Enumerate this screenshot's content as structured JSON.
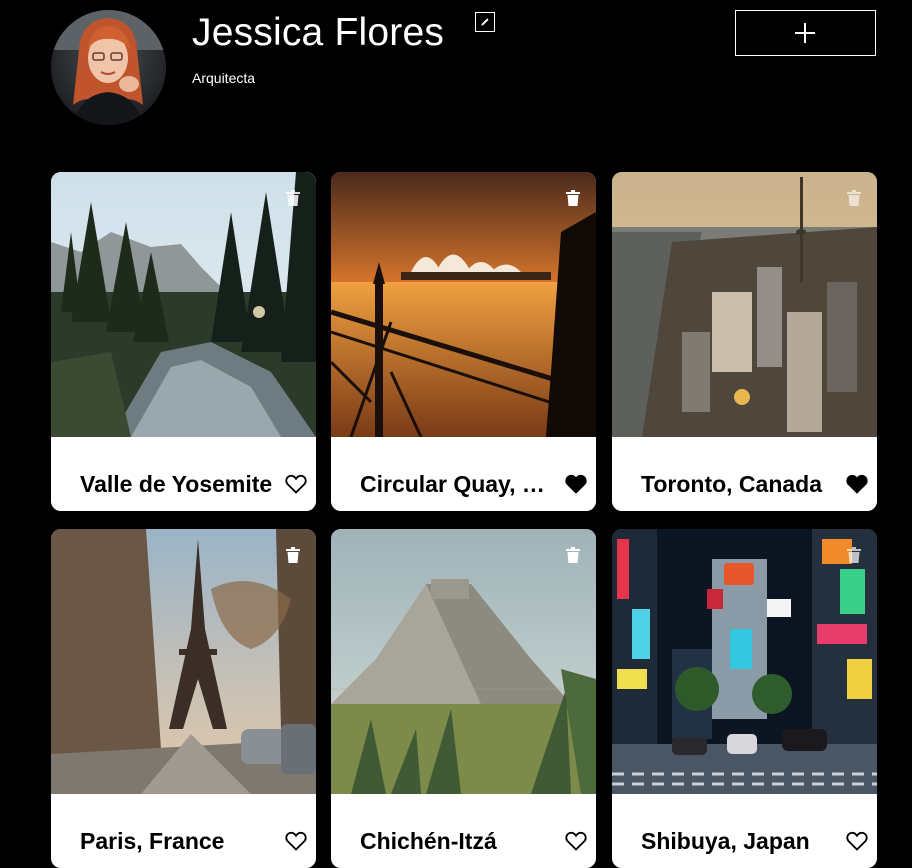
{
  "profile": {
    "name": "Jessica Flores",
    "job": "Arquitecta"
  },
  "cards": [
    {
      "title": "Valle de Yosemite",
      "liked": false
    },
    {
      "title": "Circular Quay, Sydney",
      "liked": true
    },
    {
      "title": "Toronto, Canada",
      "liked": true
    },
    {
      "title": "Paris, France",
      "liked": false
    },
    {
      "title": "Chichén-Itzá",
      "liked": false
    },
    {
      "title": "Shibuya, Japan",
      "liked": false
    }
  ],
  "colors": {
    "background": "#000000",
    "card": "#ffffff",
    "text": "#ffffff",
    "card_title": "#000000"
  },
  "icons": {
    "edit": "pencil-icon",
    "add": "plus-icon",
    "delete": "trash-icon",
    "like": "heart-icon"
  }
}
